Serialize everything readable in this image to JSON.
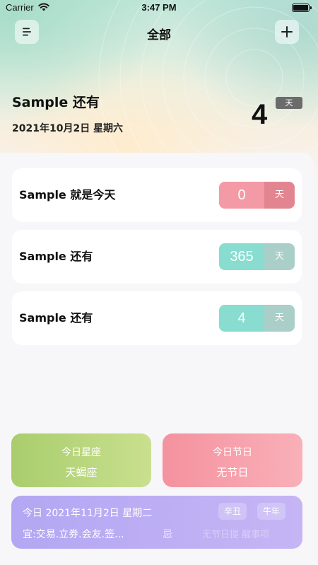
{
  "status_bar": {
    "carrier": "Carrier",
    "time": "3:47 PM"
  },
  "nav": {
    "title": "全部",
    "menu_icon": "menu-icon",
    "add_icon": "plus-icon"
  },
  "hero": {
    "label": "Sample 还有",
    "date": "2021年10月2日 星期六",
    "count": "4",
    "unit": "天"
  },
  "events": [
    {
      "label": "Sample 就是今天",
      "count": "0",
      "unit": "天",
      "color": "#f39aa6"
    },
    {
      "label": "Sample 还有",
      "count": "365",
      "unit": "天",
      "color": "#88ddd0"
    },
    {
      "label": "Sample 还有",
      "count": "4",
      "unit": "天",
      "color": "#88ddd0"
    }
  ],
  "tiles": {
    "zodiac": {
      "title": "今日星座",
      "value": "天蝎座",
      "color": "#b6d57b"
    },
    "holiday": {
      "title": "今日节日",
      "value": "无节日",
      "color": "#f6a0aa"
    }
  },
  "almanac": {
    "date": "今日 2021年11月2日 星期二",
    "year_ganzhi": "辛丑",
    "year_zodiac": "牛年",
    "yi": "宜:交易.立券.会友.签...",
    "ji": "忌",
    "ji_items": "无节日提 醒事项"
  }
}
